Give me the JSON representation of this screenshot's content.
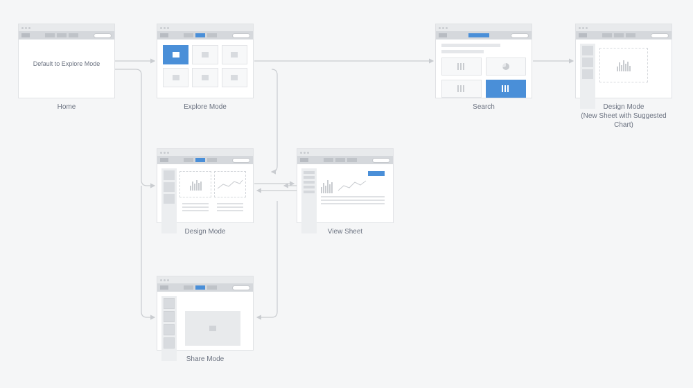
{
  "nodes": {
    "home": {
      "caption": "Home",
      "body_text": "Default to Explore Mode"
    },
    "explore": {
      "caption": "Explore Mode"
    },
    "search": {
      "caption": "Search"
    },
    "design_suggested": {
      "caption": "Design Mode\n(New Sheet with Suggested\nChart)"
    },
    "design": {
      "caption": "Design Mode"
    },
    "view_sheet": {
      "caption": "View Sheet"
    },
    "share": {
      "caption": "Share Mode"
    }
  },
  "colors": {
    "accent": "#4a8fd8",
    "frame_border": "#e0e2e5",
    "text": "#6b7280"
  }
}
